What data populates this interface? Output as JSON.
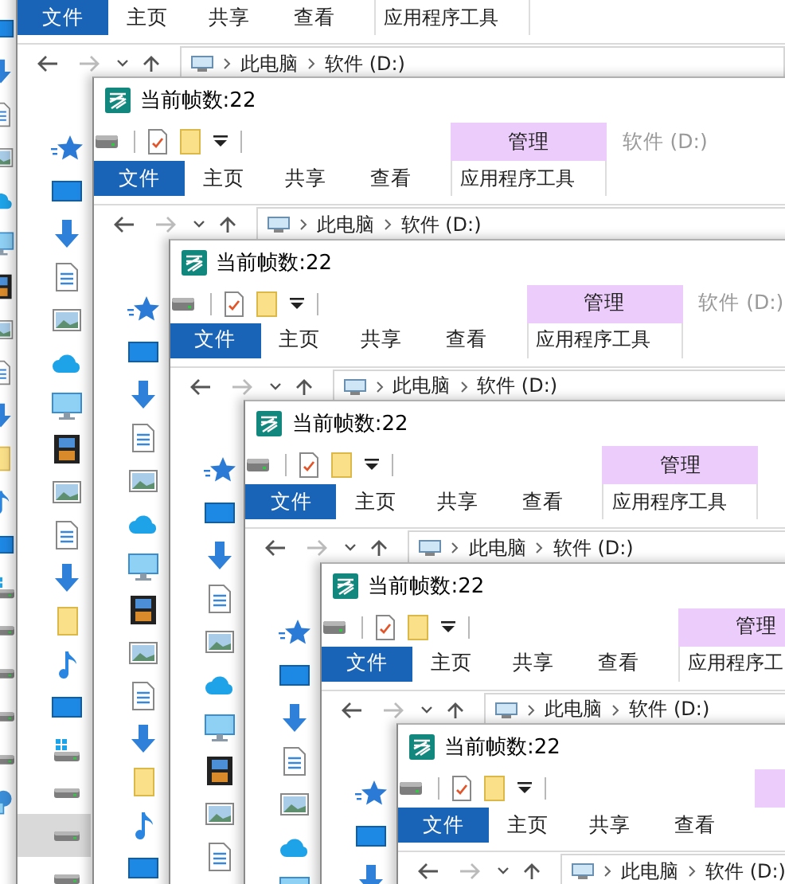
{
  "windows": [
    {
      "nav_items": [
        {
          "kind": "desktop",
          "selected": false
        },
        {
          "kind": "download",
          "selected": false
        },
        {
          "kind": "document",
          "selected": false
        },
        {
          "kind": "picture",
          "selected": false
        },
        {
          "kind": "cloud",
          "selected": false
        },
        {
          "kind": "monitor",
          "selected": false
        },
        {
          "kind": "video",
          "selected": false
        },
        {
          "kind": "picture",
          "selected": false
        },
        {
          "kind": "document",
          "selected": false
        },
        {
          "kind": "download",
          "selected": false
        },
        {
          "kind": "folder",
          "selected": false
        },
        {
          "kind": "music",
          "selected": false
        },
        {
          "kind": "desktop",
          "selected": false
        },
        {
          "kind": "windows-drive",
          "selected": false
        },
        {
          "kind": "drive",
          "selected": false
        },
        {
          "kind": "drive",
          "selected": false
        },
        {
          "kind": "drive",
          "selected": false
        },
        {
          "kind": "drive",
          "selected": false
        },
        {
          "kind": "network",
          "selected": false
        }
      ]
    },
    {
      "tabs": [
        {
          "label": "文件",
          "kind": "file"
        },
        {
          "label": "主页",
          "kind": "standard"
        },
        {
          "label": "共享",
          "kind": "standard"
        },
        {
          "label": "查看",
          "kind": "standard"
        },
        {
          "label": "应用程序工具",
          "kind": "contextual"
        }
      ],
      "address": [
        "此电脑",
        "软件 (D:)"
      ],
      "nav_items": [
        {
          "kind": "star",
          "selected": false
        },
        {
          "kind": "desktop",
          "selected": false
        },
        {
          "kind": "download",
          "selected": false
        },
        {
          "kind": "document",
          "selected": false
        },
        {
          "kind": "picture",
          "selected": false
        },
        {
          "kind": "cloud",
          "selected": false
        },
        {
          "kind": "monitor",
          "selected": false
        },
        {
          "kind": "video",
          "selected": false
        },
        {
          "kind": "picture",
          "selected": false
        },
        {
          "kind": "document",
          "selected": false
        },
        {
          "kind": "download",
          "selected": false
        },
        {
          "kind": "folder",
          "selected": false
        },
        {
          "kind": "music",
          "selected": false
        },
        {
          "kind": "desktop",
          "selected": false
        },
        {
          "kind": "windows-drive",
          "selected": false
        },
        {
          "kind": "drive",
          "selected": false
        },
        {
          "kind": "drive",
          "selected": true
        },
        {
          "kind": "drive",
          "selected": false
        }
      ]
    },
    {
      "title": "当前帧数:22",
      "tool_header": true,
      "tool_header_label": "管理",
      "location_label": "软件 (D:)",
      "tabs": [
        {
          "label": "文件",
          "kind": "file"
        },
        {
          "label": "主页",
          "kind": "standard"
        },
        {
          "label": "共享",
          "kind": "standard"
        },
        {
          "label": "查看",
          "kind": "standard"
        },
        {
          "label": "应用程序工具",
          "kind": "contextual"
        }
      ],
      "address": [
        "此电脑",
        "软件 (D:)"
      ],
      "nav_items": [
        {
          "kind": "star",
          "selected": false
        },
        {
          "kind": "desktop",
          "selected": false
        },
        {
          "kind": "download",
          "selected": false
        },
        {
          "kind": "document",
          "selected": false
        },
        {
          "kind": "picture",
          "selected": false
        },
        {
          "kind": "cloud",
          "selected": false
        },
        {
          "kind": "monitor",
          "selected": false
        },
        {
          "kind": "video",
          "selected": false
        },
        {
          "kind": "picture",
          "selected": false
        },
        {
          "kind": "document",
          "selected": false
        },
        {
          "kind": "download",
          "selected": false
        },
        {
          "kind": "folder",
          "selected": false
        },
        {
          "kind": "music",
          "selected": false
        },
        {
          "kind": "desktop",
          "selected": false
        }
      ]
    },
    {
      "title": "当前帧数:22",
      "tool_header": true,
      "tool_header_label": "管理",
      "location_label": "软件 (D:)",
      "tabs": [
        {
          "label": "文件",
          "kind": "file"
        },
        {
          "label": "主页",
          "kind": "standard"
        },
        {
          "label": "共享",
          "kind": "standard"
        },
        {
          "label": "查看",
          "kind": "standard"
        },
        {
          "label": "应用程序工具",
          "kind": "contextual"
        }
      ],
      "address": [
        "此电脑",
        "软件 (D:)"
      ],
      "nav_items": [
        {
          "kind": "star",
          "selected": false
        },
        {
          "kind": "desktop",
          "selected": false
        },
        {
          "kind": "download",
          "selected": false
        },
        {
          "kind": "document",
          "selected": false
        },
        {
          "kind": "picture",
          "selected": false
        },
        {
          "kind": "cloud",
          "selected": false
        },
        {
          "kind": "monitor",
          "selected": false
        },
        {
          "kind": "video",
          "selected": false
        },
        {
          "kind": "picture",
          "selected": false
        },
        {
          "kind": "document",
          "selected": false
        }
      ]
    },
    {
      "title": "当前帧数:22",
      "tool_header": true,
      "tool_header_label": "管理",
      "tabs": [
        {
          "label": "文件",
          "kind": "file"
        },
        {
          "label": "主页",
          "kind": "standard"
        },
        {
          "label": "共享",
          "kind": "standard"
        },
        {
          "label": "查看",
          "kind": "standard"
        },
        {
          "label": "应用程序工具",
          "kind": "contextual"
        }
      ],
      "address": [
        "此电脑",
        "软件 (D:)"
      ],
      "nav_items": [
        {
          "kind": "star",
          "selected": false
        },
        {
          "kind": "desktop",
          "selected": false
        },
        {
          "kind": "download",
          "selected": false
        },
        {
          "kind": "document",
          "selected": false
        },
        {
          "kind": "picture",
          "selected": false
        },
        {
          "kind": "cloud",
          "selected": false
        },
        {
          "kind": "monitor",
          "selected": false
        }
      ]
    },
    {
      "title": "当前帧数:22",
      "tool_header": true,
      "tool_header_label": "管理",
      "tabs": [
        {
          "label": "文件",
          "kind": "file"
        },
        {
          "label": "主页",
          "kind": "standard"
        },
        {
          "label": "共享",
          "kind": "standard"
        },
        {
          "label": "查看",
          "kind": "standard"
        },
        {
          "label": "应用程序工",
          "kind": "contextual"
        }
      ],
      "address": [
        "此电脑",
        "软件 (D:)"
      ],
      "nav_items": [
        {
          "kind": "star",
          "selected": false
        },
        {
          "kind": "desktop",
          "selected": false
        },
        {
          "kind": "download",
          "selected": false
        }
      ]
    },
    {
      "title": "当前帧数:22",
      "tool_header": true,
      "tabs": [
        {
          "label": "文件",
          "kind": "file"
        },
        {
          "label": "主页",
          "kind": "standard"
        },
        {
          "label": "共享",
          "kind": "standard"
        },
        {
          "label": "查看",
          "kind": "standard"
        }
      ],
      "address": [
        "此电脑",
        "软件 (D:)"
      ]
    }
  ]
}
